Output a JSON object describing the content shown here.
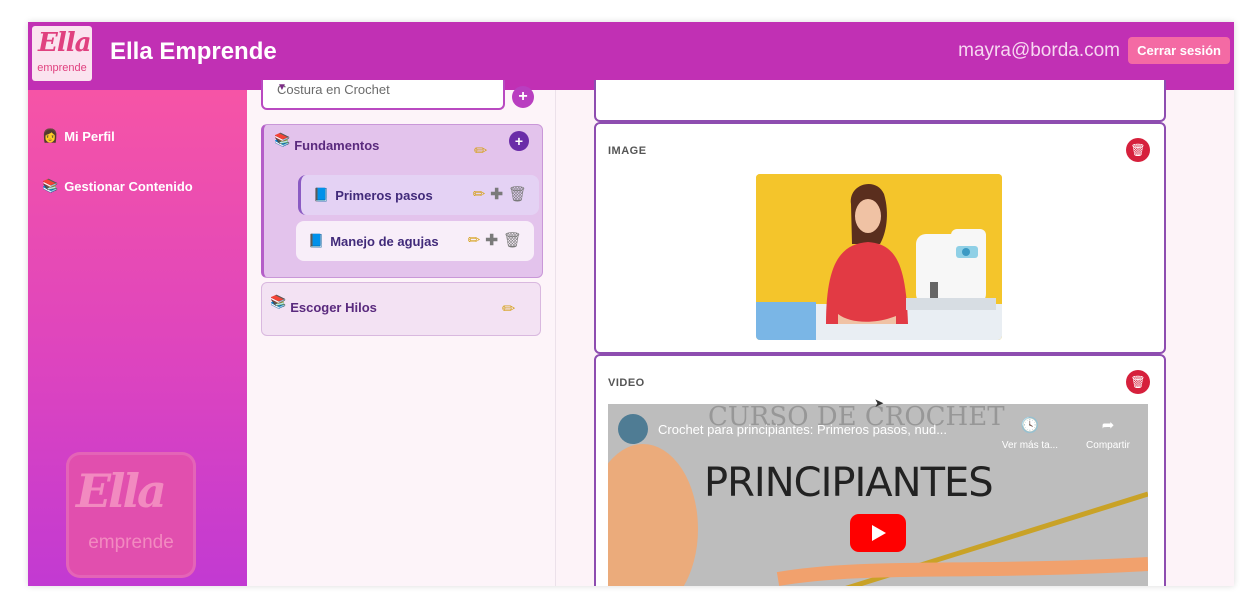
{
  "app": {
    "logo_main": "Ella",
    "logo_sub": "emprende",
    "title": "Ella Emprende"
  },
  "header": {
    "user_email": "mayra@borda.com",
    "logout_label": "Cerrar sesión"
  },
  "sidebar": {
    "items": [
      {
        "icon": "person-icon",
        "label": "Mi Perfil"
      },
      {
        "icon": "book-stack-icon",
        "label": "Gestionar Contenido"
      }
    ],
    "logo_main": "Ella",
    "logo_sub": "emprende"
  },
  "courses": {
    "selected": "Costura en Crochet",
    "modules": [
      {
        "title": "Fundamentos",
        "lessons": [
          {
            "title": "Primeros pasos"
          },
          {
            "title": "Manejo de agujas"
          }
        ]
      },
      {
        "title": "Escoger Hilos",
        "lessons": []
      }
    ]
  },
  "content": {
    "blocks": [
      {
        "type": "IMAGE"
      },
      {
        "type": "VIDEO",
        "video_title": "Crochet para principiantes: Primeros pasos, nud...",
        "watch_later": "Ver más ta...",
        "share": "Compartir",
        "thumb_text": "PRINCIPIANTES",
        "thumb_header": "CURSO DE CROCHET"
      }
    ]
  },
  "colors": {
    "header": "#c130b4",
    "accent": "#b93ec0",
    "delete": "#d6203c",
    "edit": "#d6a21c"
  }
}
